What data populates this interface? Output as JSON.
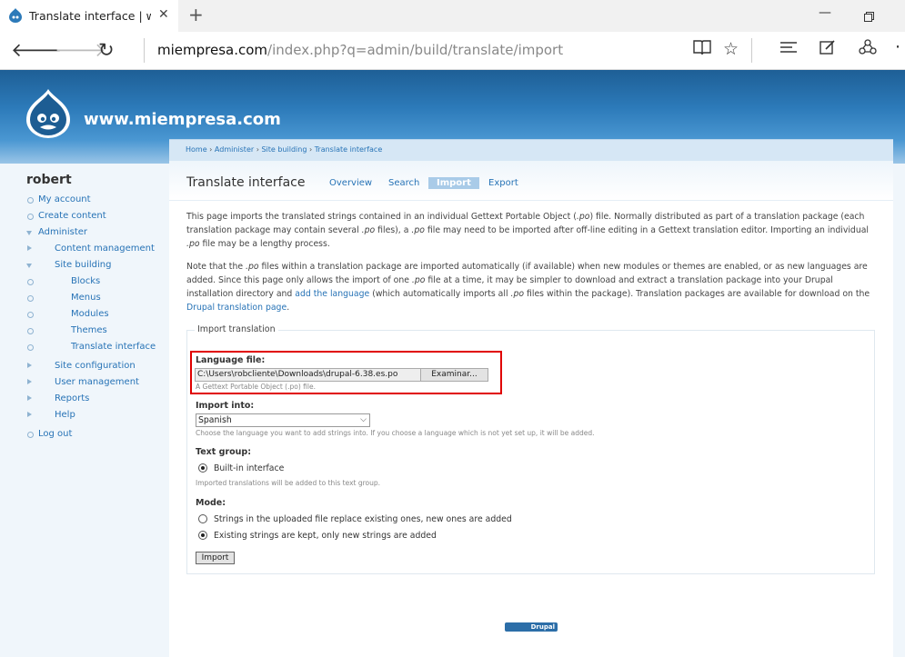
{
  "browser": {
    "tab_title": "Translate interface | www",
    "url_host": "miempresa.com",
    "url_path": "/index.php?q=admin/build/translate/import"
  },
  "site": {
    "name": "www.miempresa.com"
  },
  "sidebar": {
    "user": "robert",
    "items": [
      {
        "label": "My account"
      },
      {
        "label": "Create content"
      },
      {
        "label": "Administer"
      },
      {
        "label": "Content management"
      },
      {
        "label": "Site building"
      },
      {
        "label": "Blocks"
      },
      {
        "label": "Menus"
      },
      {
        "label": "Modules"
      },
      {
        "label": "Themes"
      },
      {
        "label": "Translate interface"
      },
      {
        "label": "Site configuration"
      },
      {
        "label": "User management"
      },
      {
        "label": "Reports"
      },
      {
        "label": "Help"
      },
      {
        "label": "Log out"
      }
    ]
  },
  "breadcrumb": [
    "Home",
    "Administer",
    "Site building",
    "Translate interface"
  ],
  "page": {
    "title": "Translate interface",
    "tabs": [
      {
        "label": "Overview",
        "active": false
      },
      {
        "label": "Search",
        "active": false
      },
      {
        "label": "Import",
        "active": true
      },
      {
        "label": "Export",
        "active": false
      }
    ]
  },
  "intro": {
    "p1_a": "This page imports the translated strings contained in an individual Gettext Portable Object (",
    "po": ".po",
    "p1_b": ") file. Normally distributed as part of a translation package (each translation package may contain several ",
    "p1_c": " files), a ",
    "p1_d": " file may need to be imported after off-line editing in a Gettext translation editor. Importing an individual ",
    "p1_e": " file may be a lengthy process.",
    "p2_a": "Note that the ",
    "p2_b": " files within a translation package are imported automatically (if available) when new modules or themes are enabled, or as new languages are added. Since this page only allows the import of one ",
    "p2_c": " file at a time, it may be simpler to download and extract a translation package into your Drupal installation directory and ",
    "p2_link1": "add the language",
    "p2_d": " (which automatically imports all ",
    "p2_e": " files within the package). Translation packages are available for download on the ",
    "p2_link2": "Drupal translation page",
    "p2_f": "."
  },
  "form": {
    "legend": "Import translation",
    "language_file_label": "Language file:",
    "file_value": "C:\\Users\\robcliente\\Downloads\\drupal-6.38.es.po",
    "browse_label": "Examinar...",
    "file_desc": "A Gettext Portable Object (.po) file.",
    "import_into_label": "Import into:",
    "import_into_value": "Spanish",
    "import_into_desc": "Choose the language you want to add strings into. If you choose a language which is not yet set up, it will be added.",
    "text_group_label": "Text group:",
    "text_group_option": "Built-in interface",
    "text_group_desc": "Imported translations will be added to this text group.",
    "mode_label": "Mode:",
    "mode_option_replace": "Strings in the uploaded file replace existing ones, new ones are added",
    "mode_option_keep": "Existing strings are kept, only new strings are added",
    "import_button": "Import"
  },
  "footer": {
    "powered_by": "Drupal"
  },
  "colors": {
    "link": "#2773b6",
    "header_dark": "#1e5f96",
    "highlight": "#e00000"
  }
}
